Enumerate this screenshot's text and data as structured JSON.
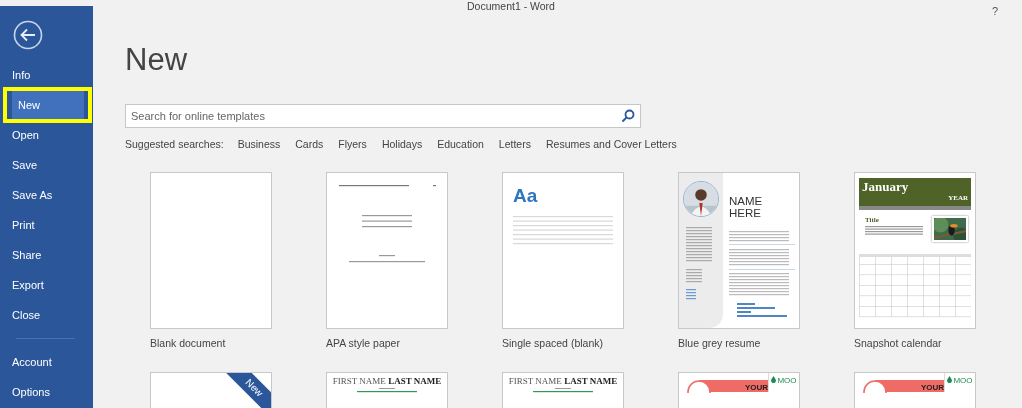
{
  "window": {
    "title": "Document1 - Word",
    "help": "?"
  },
  "sidebar": {
    "items": [
      {
        "label": "Info",
        "selected": false,
        "highlighted": false
      },
      {
        "label": "New",
        "selected": true,
        "highlighted": true
      },
      {
        "label": "Open",
        "selected": false,
        "highlighted": false
      },
      {
        "label": "Save",
        "selected": false,
        "highlighted": false
      },
      {
        "label": "Save As",
        "selected": false,
        "highlighted": false
      },
      {
        "label": "Print",
        "selected": false,
        "highlighted": false
      },
      {
        "label": "Share",
        "selected": false,
        "highlighted": false
      },
      {
        "label": "Export",
        "selected": false,
        "highlighted": false
      },
      {
        "label": "Close",
        "selected": false,
        "highlighted": false
      }
    ],
    "bottom_items": [
      {
        "label": "Account",
        "selected": false,
        "highlighted": false
      },
      {
        "label": "Options",
        "selected": false,
        "highlighted": false
      }
    ]
  },
  "heading": "New",
  "search": {
    "placeholder": "Search for online templates"
  },
  "suggested": {
    "label": "Suggested searches:",
    "links": [
      "Business",
      "Cards",
      "Flyers",
      "Holidays",
      "Education",
      "Letters",
      "Resumes and Cover Letters"
    ]
  },
  "templates": [
    {
      "kind": "blank",
      "label": "Blank document"
    },
    {
      "kind": "apa",
      "label": "APA style paper"
    },
    {
      "kind": "single",
      "label": "Single spaced (blank)",
      "texts": [
        "Aa"
      ]
    },
    {
      "kind": "resume",
      "label": "Blue grey resume",
      "texts": [
        "NAME HERE"
      ]
    },
    {
      "kind": "calendar",
      "label": "Snapshot calendar",
      "texts": [
        "January",
        "YEAR",
        "Title"
      ]
    },
    {
      "kind": "banner",
      "texts": [
        "New"
      ]
    },
    {
      "kind": "name",
      "texts": [
        "FIRST NAME **LAST NAME**"
      ]
    },
    {
      "kind": "name",
      "texts": [
        "FIRST NAME **LAST NAME**"
      ]
    },
    {
      "kind": "card",
      "texts": [
        "YOUR",
        "MOO"
      ]
    },
    {
      "kind": "card",
      "texts": [
        "YOUR",
        "MOO"
      ]
    }
  ]
}
